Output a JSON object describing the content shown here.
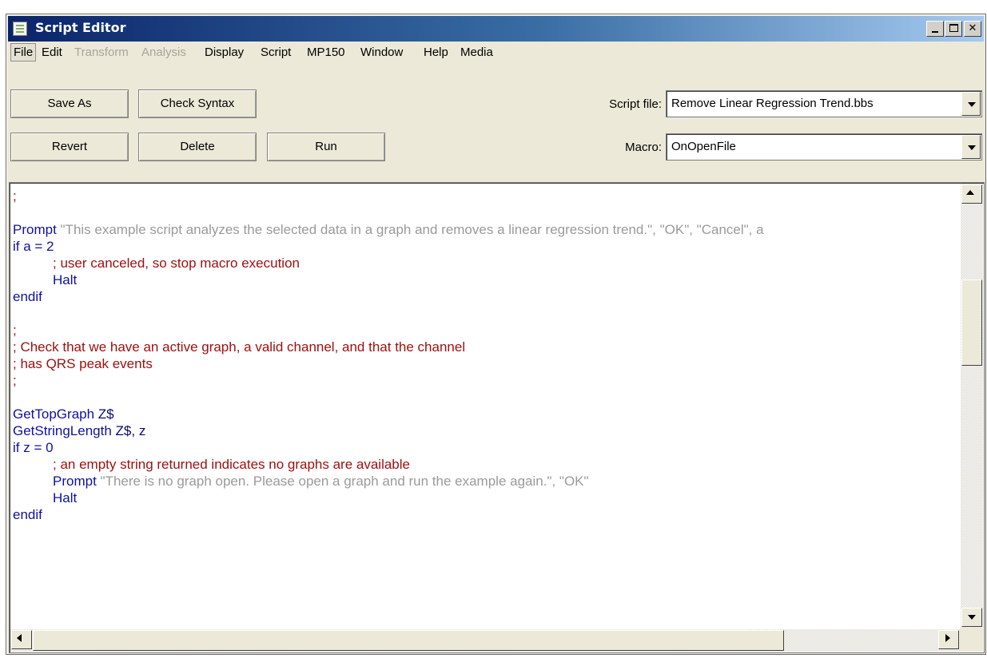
{
  "window": {
    "title": "Script Editor",
    "icon": "script-editor-app-icon",
    "controls": {
      "minimize": "minimize-icon",
      "maximize": "maximize-icon",
      "close": "close-icon",
      "close_glyph": "✕"
    }
  },
  "menu": {
    "items": [
      {
        "label": "File",
        "enabled": true,
        "active": true
      },
      {
        "label": "Edit",
        "enabled": true
      },
      {
        "label": "Transform",
        "enabled": false
      },
      {
        "label": "Analysis",
        "enabled": false
      },
      {
        "label": "Display",
        "enabled": true
      },
      {
        "label": "Script",
        "enabled": true
      },
      {
        "label": "MP150",
        "enabled": true
      },
      {
        "label": "Window",
        "enabled": true
      },
      {
        "label": "Help",
        "enabled": true
      },
      {
        "label": "Media",
        "enabled": true
      }
    ]
  },
  "toolbar": {
    "save_as": "Save As",
    "check_syntax": "Check Syntax",
    "revert": "Revert",
    "delete": "Delete",
    "run": "Run",
    "script_file_label": "Script file:",
    "script_file_value": "Remove Linear Regression Trend.bbs",
    "macro_label": "Macro:",
    "macro_value": "OnOpenFile"
  },
  "editor": {
    "lines": [
      [
        {
          "t": ";",
          "c": "cm"
        }
      ],
      [],
      [
        {
          "t": "Prompt",
          "c": "kw"
        },
        {
          "t": " \"This example script analyzes the selected data in a graph and removes a linear regression trend.\", \"OK\", \"Cancel\", a",
          "c": "str"
        }
      ],
      [
        {
          "t": "if a = 2",
          "c": "kw"
        }
      ],
      [
        {
          "t": "\t",
          "c": "in"
        },
        {
          "t": "; user canceled, so stop macro execution",
          "c": "cm"
        }
      ],
      [
        {
          "t": "\t",
          "c": "in"
        },
        {
          "t": "Halt",
          "c": "kw"
        }
      ],
      [
        {
          "t": "endif",
          "c": "kw"
        }
      ],
      [],
      [
        {
          "t": ";",
          "c": "cm"
        }
      ],
      [
        {
          "t": "; Check that we have an active graph, a valid channel, and that the channel",
          "c": "cm"
        }
      ],
      [
        {
          "t": "; has QRS peak events",
          "c": "cm"
        }
      ],
      [
        {
          "t": ";",
          "c": "cm"
        }
      ],
      [],
      [
        {
          "t": "GetTopGraph",
          "c": "kw"
        },
        {
          "t": " Z$",
          "c": "pl"
        }
      ],
      [
        {
          "t": "GetStringLength",
          "c": "kw"
        },
        {
          "t": " Z$, z",
          "c": "pl"
        }
      ],
      [
        {
          "t": "if z = 0",
          "c": "kw"
        }
      ],
      [
        {
          "t": "\t",
          "c": "in"
        },
        {
          "t": "; an empty string returned indicates no graphs are available",
          "c": "cm"
        }
      ],
      [
        {
          "t": "\t",
          "c": "in"
        },
        {
          "t": "Prompt",
          "c": "kw"
        },
        {
          "t": " \"There is no graph open. Please open a graph and run the example again.\", \"OK\"",
          "c": "str"
        }
      ],
      [
        {
          "t": "\t",
          "c": "in"
        },
        {
          "t": "Halt",
          "c": "kw"
        }
      ],
      [
        {
          "t": "endif",
          "c": "kw"
        }
      ]
    ]
  },
  "scrollbars": {
    "vertical": {
      "up": "scroll-up-arrow-icon",
      "down": "scroll-down-arrow-icon"
    },
    "horizontal": {
      "left": "scroll-left-arrow-icon",
      "right": "scroll-right-arrow-icon"
    }
  },
  "colors": {
    "title_gradient_start": "#0a246a",
    "keyword": "#1010a0",
    "comment": "#a01010",
    "string": "#9a9a9a"
  }
}
